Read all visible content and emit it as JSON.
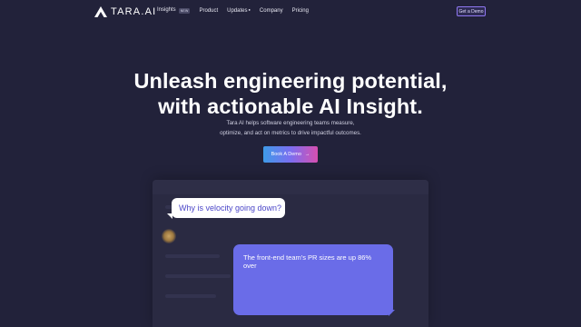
{
  "brand": {
    "logo_text": "TARA.AI"
  },
  "nav": {
    "items": [
      {
        "label": "Insights",
        "badge": "NEW"
      },
      {
        "label": "Product"
      },
      {
        "label": "Updates",
        "dot": "●"
      },
      {
        "label": "Company"
      },
      {
        "label": "Pricing"
      }
    ],
    "cta_label": "Get a Demo"
  },
  "hero": {
    "title_line1": "Unleash engineering potential,",
    "title_line2": "with actionable AI Insight.",
    "subtitle_line1": "Tara AI helps software engineering teams measure,",
    "subtitle_line2": "optimize, and act on metrics to drive impactful outcomes.",
    "cta_label": "Book A Demo",
    "cta_arrow": "→"
  },
  "chat": {
    "question": "Why is velocity going down?",
    "answer": "The front-end team's PR sizes are up 86% over"
  },
  "colors": {
    "background": "#22223a",
    "accent": "#6a6ce8",
    "question_text": "#4b46c8"
  }
}
